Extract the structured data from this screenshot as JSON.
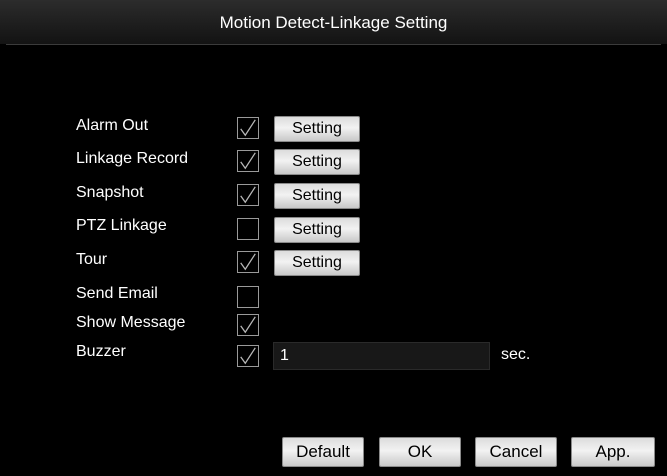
{
  "dialog": {
    "title": "Motion Detect-Linkage Setting"
  },
  "rows": [
    {
      "label": "Alarm Out",
      "checked": true,
      "setting_label": "Setting"
    },
    {
      "label": "Linkage Record",
      "checked": true,
      "setting_label": "Setting"
    },
    {
      "label": "Snapshot",
      "checked": true,
      "setting_label": "Setting"
    },
    {
      "label": "PTZ Linkage",
      "checked": false,
      "setting_label": "Setting"
    },
    {
      "label": "Tour",
      "checked": true,
      "setting_label": "Setting"
    },
    {
      "label": "Send Email",
      "checked": false
    },
    {
      "label": "Show Message",
      "checked": true
    },
    {
      "label": "Buzzer",
      "checked": true
    }
  ],
  "buzzer": {
    "value": "1",
    "unit": "sec."
  },
  "footer": {
    "default_label": "Default",
    "ok_label": "OK",
    "cancel_label": "Cancel",
    "apply_label": "App."
  },
  "colors": {
    "background": "#000000",
    "text": "#ffffff",
    "button": "#e6e6e6",
    "field": "#181818"
  }
}
